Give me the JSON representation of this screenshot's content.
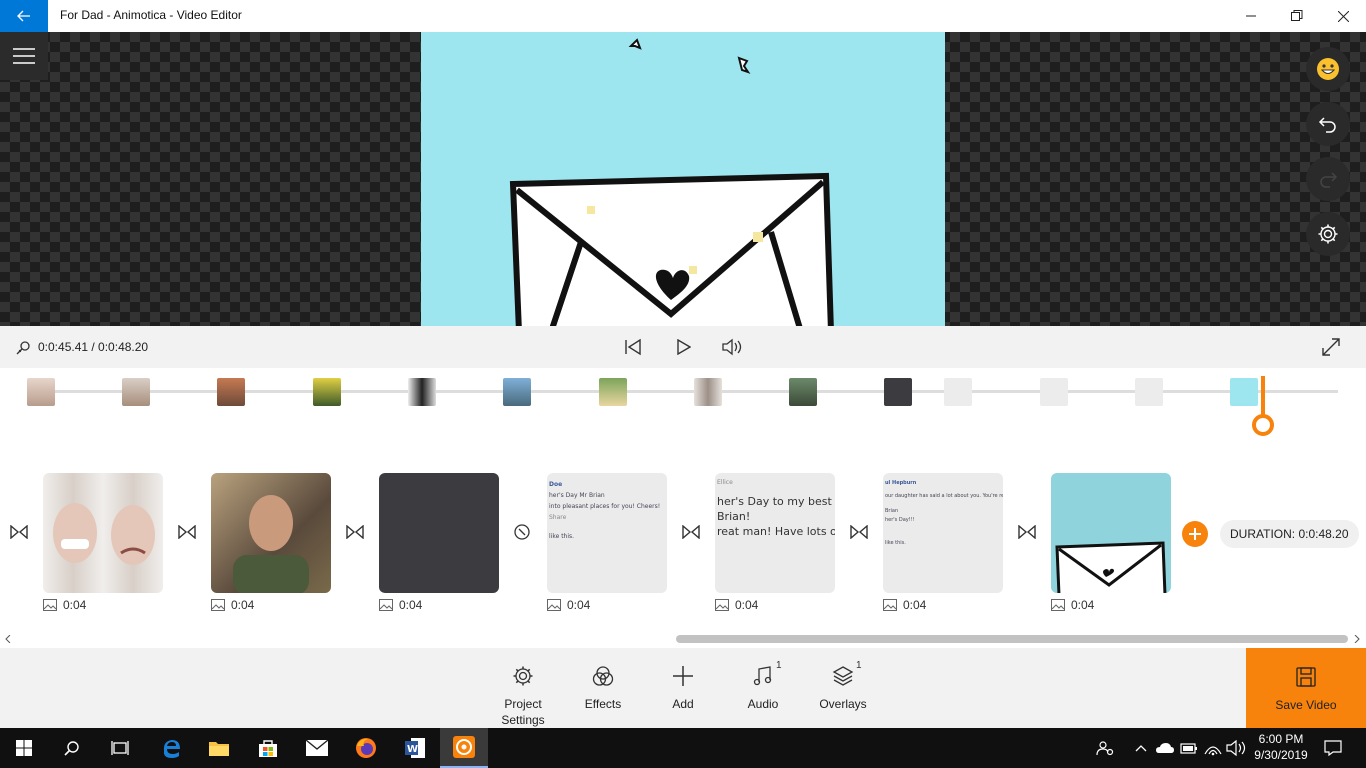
{
  "window": {
    "title": "For Dad - Animotica - Video Editor"
  },
  "playback": {
    "time_readout": "0:0:45.41 / 0:0:48.20"
  },
  "clips": [
    {
      "duration": "0:04",
      "kind": "image"
    },
    {
      "duration": "0:04",
      "kind": "image"
    },
    {
      "duration": "0:04",
      "kind": "image"
    },
    {
      "duration": "0:04",
      "kind": "image"
    },
    {
      "duration": "0:04",
      "kind": "image"
    },
    {
      "duration": "0:04",
      "kind": "image"
    },
    {
      "duration": "0:04",
      "kind": "image"
    }
  ],
  "clip_text": {
    "c4": {
      "l1": "Doe",
      "l2": "her's Day Mr Brian",
      "l3": "into pleasant places for you! Cheers!",
      "l4": "Share",
      "l5": "like this."
    },
    "c5": {
      "l1": "Ellice",
      "l2": "her's Day to my best fr",
      "l3": "Brian!",
      "l4": "reat man! Have lots of"
    },
    "c6": {
      "l1": "ul Hepburn",
      "l2": "our daughter has said a lot about you. You're really",
      "l3": "Brian",
      "l4": "her's Day!!!",
      "l5": "like this."
    }
  },
  "timeline": {
    "duration_label": "DURATION: 0:0:48.20"
  },
  "toolbar": {
    "project_settings": "Project Settings",
    "effects": "Effects",
    "add": "Add",
    "audio": "Audio",
    "audio_badge": "1",
    "overlays": "Overlays",
    "overlays_badge": "1",
    "save_video": "Save Video"
  },
  "taskbar": {
    "time": "6:00 PM",
    "date": "9/30/2019"
  },
  "colors": {
    "accent": "#f7820c",
    "title_back": "#0078d7",
    "frame_bg": "#9de6ef"
  },
  "icons": [
    "back-arrow-icon",
    "minimize-icon",
    "maximize-icon",
    "close-icon",
    "hamburger-icon",
    "emoji-icon",
    "undo-icon",
    "redo-icon",
    "gear-icon",
    "link-icon",
    "skip-back-icon",
    "play-icon",
    "volume-icon",
    "fullscreen-icon",
    "transition-icon",
    "image-icon",
    "plus-icon",
    "music-icon",
    "layers-icon",
    "save-icon"
  ]
}
